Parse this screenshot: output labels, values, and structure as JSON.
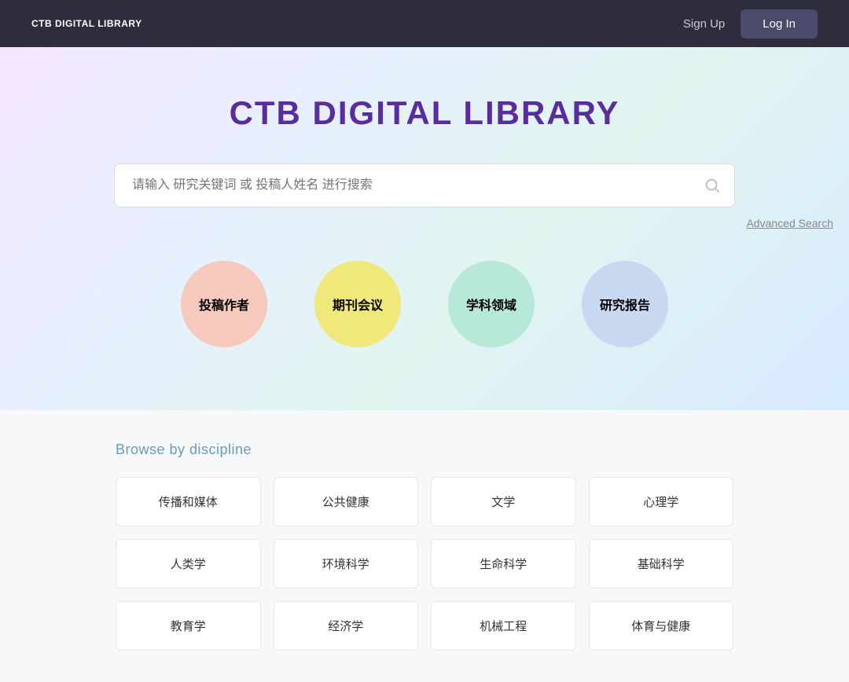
{
  "header": {
    "logo": "CTB\nDIGITAL\nLIBRARY",
    "signup_label": "Sign Up",
    "login_label": "Log In"
  },
  "hero": {
    "title": "CTB DIGITAL LIBRARY",
    "search": {
      "placeholder": "请输入 研究关键词 或 投稿人姓名 进行搜索"
    },
    "advanced_search_label": "Advanced Search",
    "bubbles": [
      {
        "label": "投稿作者",
        "color_class": "bubble-pink"
      },
      {
        "label": "期刊会议",
        "color_class": "bubble-yellow"
      },
      {
        "label": "学科领域",
        "color_class": "bubble-green"
      },
      {
        "label": "研究报告",
        "color_class": "bubble-blue"
      }
    ]
  },
  "browse": {
    "title": "Browse by discipline",
    "disciplines": [
      "传播和媒体",
      "公共健康",
      "文学",
      "心理学",
      "人类学",
      "环境科学",
      "生命科学",
      "基础科学",
      "教育学",
      "经济学",
      "机械工程",
      "体育与健康"
    ]
  }
}
